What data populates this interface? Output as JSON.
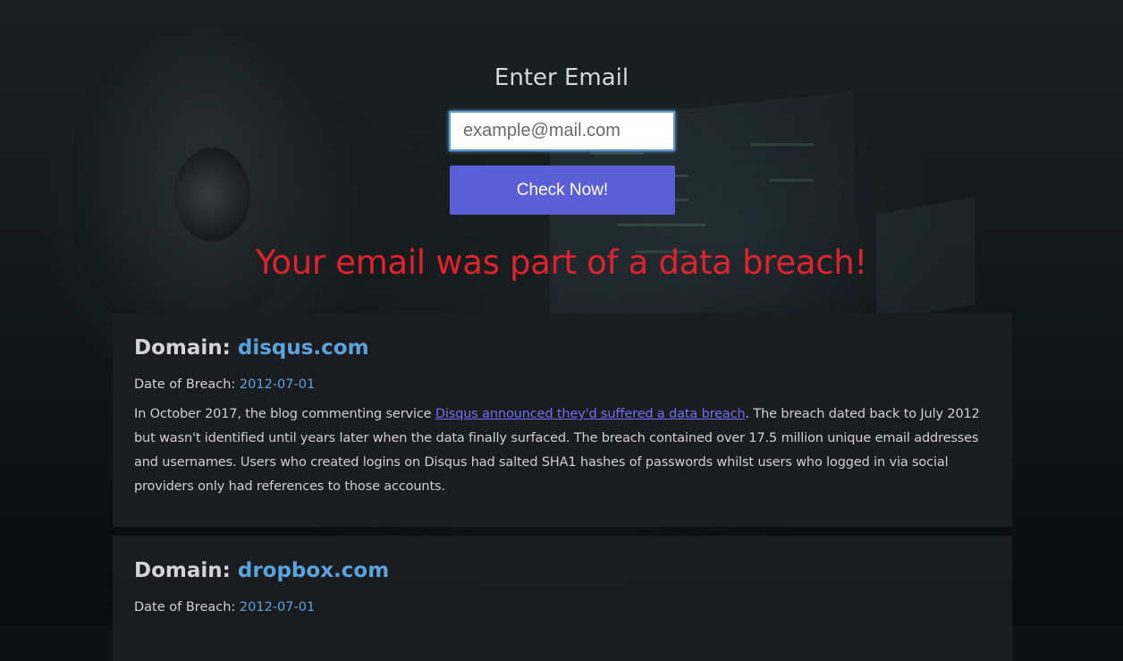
{
  "form": {
    "title": "Enter Email",
    "email_placeholder": "example@mail.com",
    "email_value": "",
    "button_label": "Check Now!"
  },
  "result": {
    "message": "Your email was part of a data breach!",
    "message_color": "#e0222e"
  },
  "breaches": [
    {
      "domain_label": "Domain:",
      "domain": "disqus.com",
      "date_label": "Date of Breach:",
      "date": "2012-07-01",
      "desc_prefix": "In October 2017, the blog commenting service ",
      "desc_link_text": "Disqus announced they'd suffered a data breach",
      "desc_suffix": ". The breach dated back to July 2012 but wasn't identified until years later when the data finally surfaced. The breach contained over 17.5 million unique email addresses and usernames. Users who created logins on Disqus had salted SHA1 hashes of passwords whilst users who logged in via social providers only had references to those accounts."
    },
    {
      "domain_label": "Domain:",
      "domain": "dropbox.com",
      "date_label": "Date of Breach:",
      "date": "2012-07-01"
    }
  ],
  "colors": {
    "accent_button": "#5a5fd6",
    "domain_link": "#5aa3dc",
    "card_bg": "#1c1d20"
  }
}
